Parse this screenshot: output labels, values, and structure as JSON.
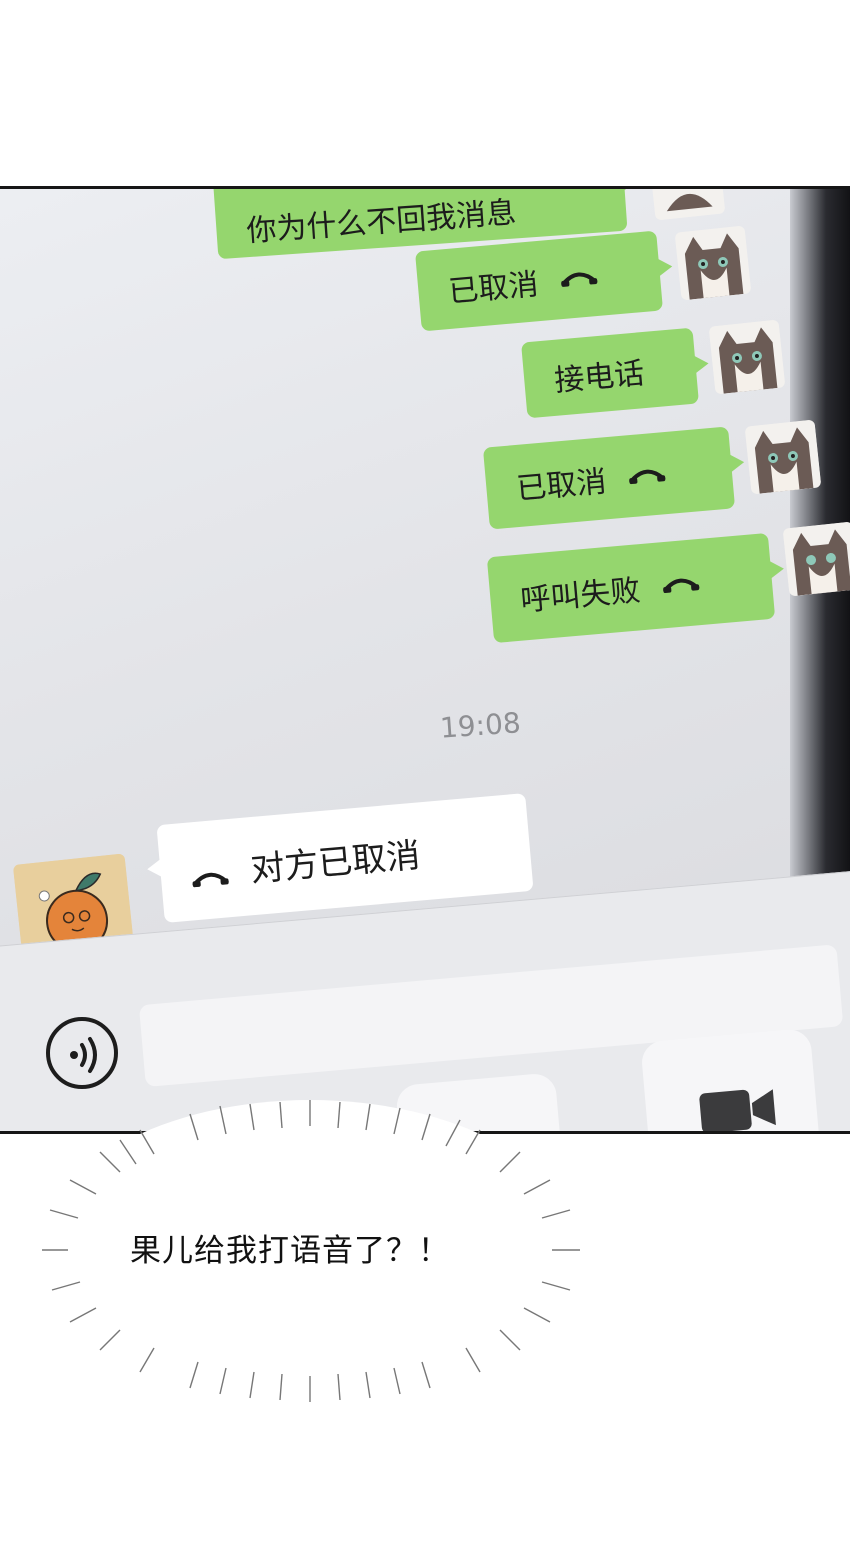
{
  "chat": {
    "top_message": "你为什么不回我消息",
    "outgoing": [
      {
        "text": "已取消",
        "phone_icon": "phone-handset-icon"
      },
      {
        "text": "接电话",
        "phone_icon": ""
      },
      {
        "text": "已取消",
        "phone_icon": "phone-handset-icon"
      },
      {
        "text": "呼叫失败",
        "phone_icon": "phone-handset-icon"
      }
    ],
    "timestamp": "19:08",
    "incoming": {
      "text": "对方已取消",
      "phone_icon": "phone-handset-icon"
    }
  },
  "input_bar": {
    "voice_icon": "voice-wave-icon",
    "video_icon": "video-camera-icon"
  },
  "caption": {
    "thought_text": "果儿给我打语音了？！"
  },
  "colors": {
    "outgoing_bubble": "#95d66e",
    "incoming_bubble": "#ffffff",
    "chat_background": "#e6e7eb"
  }
}
